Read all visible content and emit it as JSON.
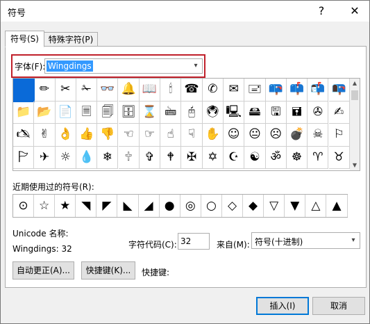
{
  "window": {
    "title": "符号",
    "help_label": "?",
    "close_label": "✕"
  },
  "tabs": [
    {
      "label": "符号(S)"
    },
    {
      "label": "特殊字符(P)"
    }
  ],
  "font": {
    "label": "字体(F):",
    "value": "Wingdings",
    "dropdown_icon": "▾"
  },
  "symbol_grid": {
    "rows": [
      [
        "",
        "✏",
        "✂",
        "✁",
        "👓",
        "🔔",
        "📖",
        "🕯",
        "☎",
        "✆",
        "✉",
        "🖃",
        "📪",
        "📫",
        "📬",
        "📭"
      ],
      [
        "📁",
        "📂",
        "📄",
        "🗏",
        "🗐",
        "🗄",
        "⌛",
        "🖮",
        "🖰",
        "🖲",
        "🖳",
        "🖴",
        "🖫",
        "🖬",
        "✇",
        "✍"
      ],
      [
        "🖎",
        "✌",
        "👌",
        "👍",
        "👎",
        "☜",
        "☞",
        "☝",
        "☟",
        "✋",
        "☺",
        "😐",
        "☹",
        "💣",
        "☠",
        "⚐"
      ],
      [
        "🏱",
        "✈",
        "☼",
        "💧",
        "❄",
        "🕆",
        "✞",
        "🕈",
        "✠",
        "✡",
        "☪",
        "☯",
        "ॐ",
        "☸",
        "♈",
        "♉"
      ]
    ],
    "selected_index": 0
  },
  "recent": {
    "label": "近期使用过的符号(R):",
    "symbols": [
      "⊙",
      "☆",
      "★",
      "◥",
      "◤",
      "◣",
      "◢",
      "●",
      "◎",
      "○",
      "◇",
      "◆",
      "▽",
      "▼",
      "△",
      "▲"
    ]
  },
  "unicode": {
    "name_label": "Unicode 名称:",
    "name_value": "Wingdings: 32"
  },
  "char_code": {
    "label": "字符代码(C):",
    "value": "32"
  },
  "from": {
    "label": "来自(M):",
    "value": "符号(十进制)"
  },
  "buttons": {
    "autocorrect": "自动更正(A)...",
    "shortcut": "快捷键(K)...",
    "shortcut_label": "快捷键:",
    "insert": "插入(I)",
    "cancel": "取消"
  },
  "colors": {
    "selection": "#0a6ad8",
    "highlight_border": "#c0202a",
    "text_selection": "#3399ff"
  }
}
